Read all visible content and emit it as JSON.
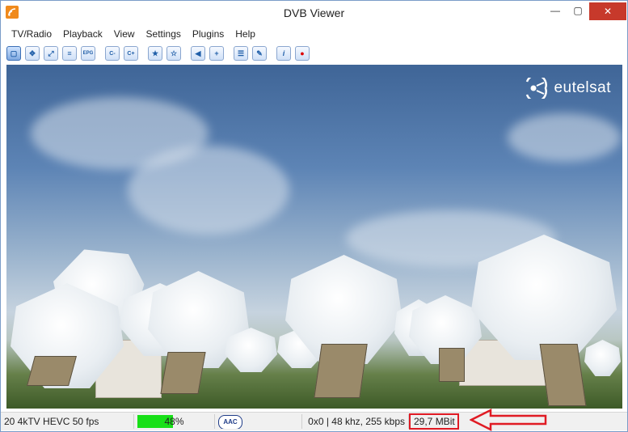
{
  "window": {
    "title": "DVB Viewer",
    "controls": {
      "minimize": "—",
      "maximize": "▢",
      "close": "✕"
    }
  },
  "menu": {
    "items": [
      "TV/Radio",
      "Playback",
      "View",
      "Settings",
      "Plugins",
      "Help"
    ]
  },
  "toolbar": {
    "buttons": [
      {
        "icon": "window-icon",
        "glyph": "▢",
        "active": true
      },
      {
        "icon": "move-icon",
        "glyph": "✥"
      },
      {
        "icon": "fullscreen-icon",
        "glyph": "⤢"
      },
      {
        "icon": "list-icon",
        "glyph": "≡"
      },
      {
        "icon": "epg-icon",
        "glyph": "EPG"
      },
      {
        "icon": "channel-prev-icon",
        "glyph": "C-"
      },
      {
        "icon": "channel-next-icon",
        "glyph": "C+"
      },
      {
        "icon": "favorite-prev-icon",
        "glyph": "★"
      },
      {
        "icon": "favorite-next-icon",
        "glyph": "☆"
      },
      {
        "icon": "back-icon",
        "glyph": "◀"
      },
      {
        "icon": "add-icon",
        "glyph": "+"
      },
      {
        "icon": "channel-list-icon",
        "glyph": "☰"
      },
      {
        "icon": "tools-icon",
        "glyph": "🔧"
      },
      {
        "icon": "info-icon",
        "glyph": "i"
      },
      {
        "icon": "record-icon",
        "glyph": "●"
      }
    ]
  },
  "video": {
    "logo_text": "eutelsat"
  },
  "status": {
    "channel": "20 4kTV HEVC 50 fps",
    "signal_percent": 48,
    "signal_text": "48%",
    "audio_codec": "AAC",
    "audio_info": "0x0 | 48 khz, 255 kbps",
    "bitrate": "29,7 MBit"
  },
  "colors": {
    "signal_bar": "#18e018",
    "highlight": "#e01b24",
    "close_button": "#c7392b"
  }
}
